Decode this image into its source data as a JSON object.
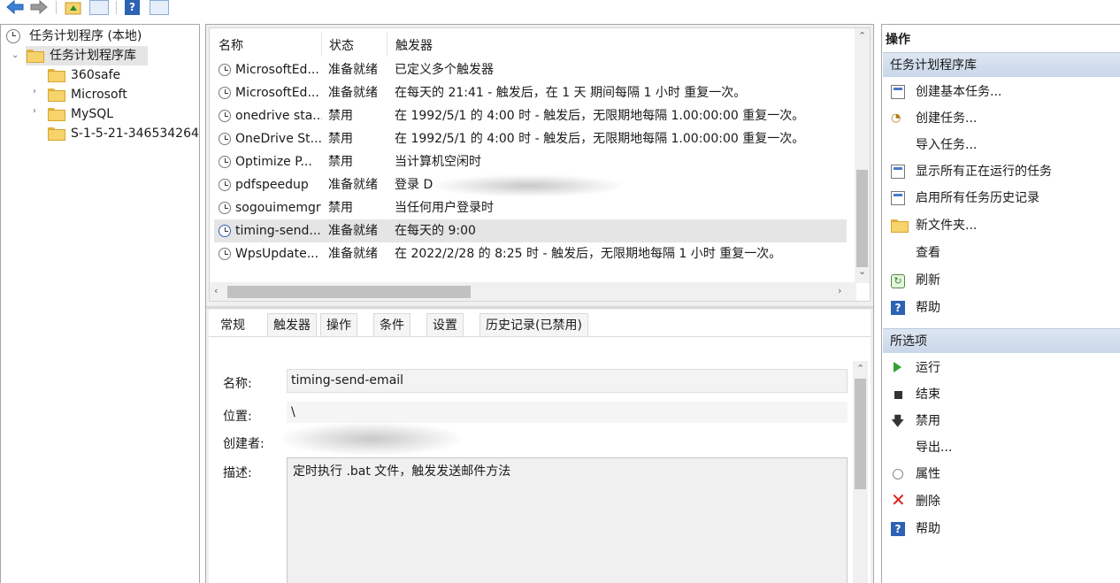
{
  "toolbar": {
    "icons": [
      "back-arrow-icon",
      "forward-arrow-icon",
      "up-folder-icon",
      "show-hide-console-tree-icon",
      "help-icon",
      "show-hide-action-pane-icon"
    ]
  },
  "tree": {
    "root": "任务计划程序 (本地)",
    "library": "任务计划程序库",
    "children": [
      "360safe",
      "Microsoft",
      "MySQL",
      "S-1-5-21-346534264"
    ]
  },
  "list": {
    "headers": [
      "名称",
      "状态",
      "触发器"
    ],
    "rows": [
      {
        "name": "MicrosoftEd...",
        "status": "准备就绪",
        "trigger": "已定义多个触发器"
      },
      {
        "name": "MicrosoftEd...",
        "status": "准备就绪",
        "trigger": "在每天的 21:41 - 触发后，在 1 天 期间每隔 1 小时 重复一次。"
      },
      {
        "name": "onedrive sta...",
        "status": "禁用",
        "trigger": "在 1992/5/1 的 4:00 时 - 触发后，无限期地每隔 1.00:00:00 重复一次。"
      },
      {
        "name": "OneDrive St...",
        "status": "禁用",
        "trigger": "在 1992/5/1 的 4:00 时 - 触发后，无限期地每隔 1.00:00:00 重复一次。"
      },
      {
        "name": "Optimize P...",
        "status": "禁用",
        "trigger": "当计算机空闲时"
      },
      {
        "name": "pdfspeedup",
        "status": "准备就绪",
        "trigger": "登录 D"
      },
      {
        "name": "sogouimemgr",
        "status": "禁用",
        "trigger": "当任何用户登录时"
      },
      {
        "name": "timing-send...",
        "status": "准备就绪",
        "trigger": "在每天的 9:00"
      },
      {
        "name": "WpsUpdate...",
        "status": "准备就绪",
        "trigger": "在 2022/2/28 的 8:25 时 - 触发后，无限期地每隔 1 小时 重复一次。"
      }
    ]
  },
  "detail": {
    "tabs": [
      "常规",
      "触发器",
      "操作",
      "条件",
      "设置",
      "历史记录(已禁用)"
    ],
    "labels": {
      "name": "名称:",
      "location": "位置:",
      "author": "创建者:",
      "description": "描述:"
    },
    "values": {
      "name": "timing-send-email",
      "location": "\\",
      "description": "定时执行 .bat 文件，触发发送邮件方法"
    }
  },
  "actions": {
    "header": "操作",
    "section1": "任务计划程序库",
    "items1": [
      "创建基本任务...",
      "创建任务...",
      "导入任务...",
      "显示所有正在运行的任务",
      "启用所有任务历史记录",
      "新文件夹...",
      "查看",
      "刷新",
      "帮助"
    ],
    "section2": "所选项",
    "items2": [
      "运行",
      "结束",
      "禁用",
      "导出...",
      "属性",
      "删除",
      "帮助"
    ]
  },
  "colors": {
    "selection": "#e5e5e5",
    "section_header": "#c9d7ea",
    "help_blue": "#2d62b4",
    "delete_red": "#e02020",
    "run_green": "#2fa22f"
  }
}
